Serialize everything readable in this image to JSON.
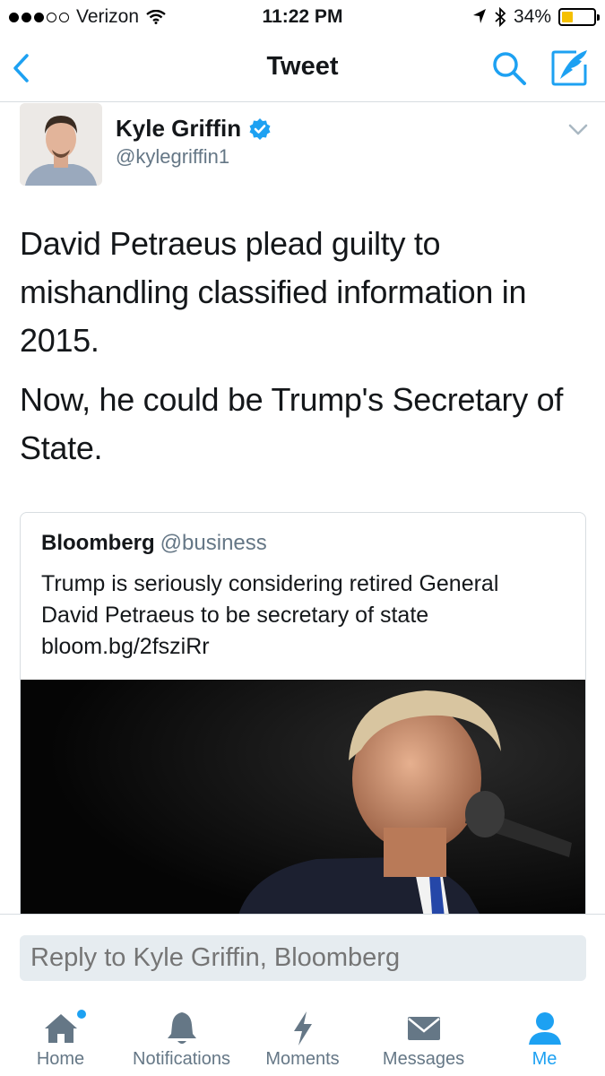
{
  "status_bar": {
    "carrier": "Verizon",
    "time": "11:22 PM",
    "battery_percent": "34%",
    "battery_level": 0.34
  },
  "nav": {
    "title": "Tweet",
    "back_icon": "chevron-left-icon",
    "search_icon": "search-icon",
    "compose_icon": "compose-tweet-icon"
  },
  "tweet": {
    "author_name": "Kyle Griffin",
    "author_handle": "@kylegriffin1",
    "verified": true,
    "paragraphs": [
      "David Petraeus plead guilty to mishandling classified information in 2015.",
      "Now, he could be Trump's Secretary of State."
    ]
  },
  "quoted_tweet": {
    "author_name": "Bloomberg",
    "author_handle": "@business",
    "text": "Trump is seriously considering retired General David Petraeus to be secretary of state bloom.bg/2fsziRr"
  },
  "reply": {
    "placeholder": "Reply to Kyle Griffin, Bloomberg"
  },
  "tabs": [
    {
      "label": "Home",
      "icon": "home-icon"
    },
    {
      "label": "Notifications",
      "icon": "bell-icon"
    },
    {
      "label": "Moments",
      "icon": "lightning-icon"
    },
    {
      "label": "Messages",
      "icon": "envelope-icon"
    },
    {
      "label": "Me",
      "icon": "person-icon"
    }
  ],
  "colors": {
    "accent": "#1da1f2",
    "secondary_text": "#657786",
    "divider": "#d8dde1",
    "battery": "#f5c000"
  }
}
